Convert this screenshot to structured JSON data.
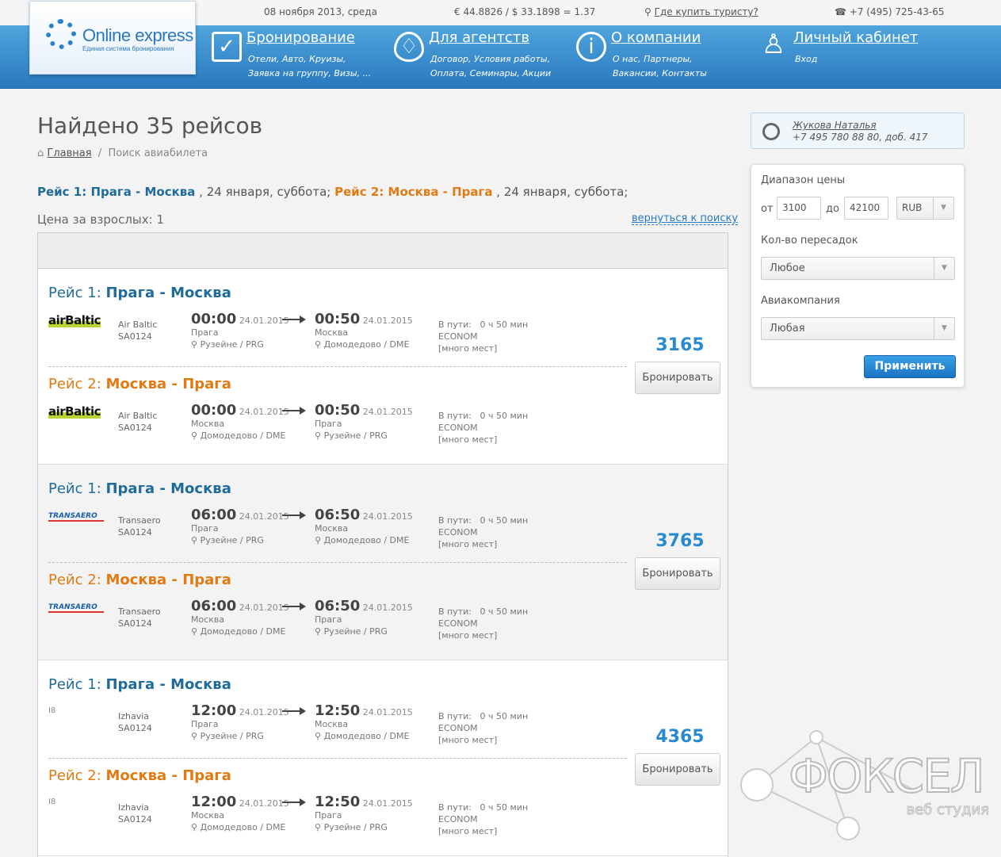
{
  "topbar": {
    "date": "08 ноября 2013, среда",
    "rates": "€ 44.8826 / $ 33.1898 = 1.37",
    "where_buy": "Где купить туристу?",
    "phone": "+7 (495) 725-43-65"
  },
  "logo": {
    "name": "Online express",
    "tagline": "Единая система бронирования"
  },
  "nav": [
    {
      "title": "Бронирование",
      "icon": "checkbox-icon",
      "links1": "Отели, Авто, Круизы,",
      "links2": "Заявка на группу, Визы, ..."
    },
    {
      "title": "Для агентств",
      "icon": "balloon-icon",
      "links1": "Договор, Условия работы,",
      "links2": "Оплата, Семинары, Акции"
    },
    {
      "title": "О компании",
      "icon": "info-icon",
      "links1": "О нас, Партнеры,",
      "links2": "Вакансии, Контакты"
    },
    {
      "title": "Личный кабинет",
      "icon": "user-icon",
      "links1": "Вход",
      "links2": ""
    }
  ],
  "page": {
    "title": "Найдено 35 рейсов",
    "crumb_home": "Главная",
    "crumb_sep": "/",
    "crumb_current": "Поиск авиабилета",
    "route_1": "Рейс 1: Прага - Москва",
    "route_1_date": " , 24 января, суббота; ",
    "route_2": "Рейс 2: Москва - Прага",
    "route_2_date": " , 24 января, суббота;",
    "adults": "Цена за взрослых: 1",
    "back": "вернуться к поиску"
  },
  "labels": {
    "leg1_prefix": "Рейс 1: ",
    "leg2_prefix": "Рейс 2: ",
    "leg1_route": "Прага - Москва",
    "leg2_route": "Москва - Прага",
    "in_way": "В пути:",
    "duration": "0 ч 50 мин",
    "class": "ECONOM",
    "seats": "[много мест]",
    "book": "Бронировать",
    "currency": "RUB",
    "flight_no": "SA0124",
    "date": "24.01.2015",
    "prague": "Прага",
    "moscow": "Москва",
    "prg": "Рузейне / PRG",
    "dme": "Домодедово / DME"
  },
  "flights": [
    {
      "airline": "Air Baltic",
      "logo": "airBaltic",
      "dep": "00:00",
      "arr": "00:50",
      "price": "3165"
    },
    {
      "airline": "Transaero",
      "logo": "TRANSAERO",
      "dep": "06:00",
      "arr": "06:50",
      "price": "3765"
    },
    {
      "airline": "Izhavia",
      "logo": "I8",
      "dep": "12:00",
      "arr": "12:50",
      "price": "4365"
    }
  ],
  "manager": {
    "name": "Жукова Наталья",
    "phone": "+7 495 780 88 80, доб. 417"
  },
  "filter": {
    "price_label": "Диапазон цены",
    "from_label": "от",
    "from_value": "3100",
    "to_label": "до",
    "to_value": "42100",
    "currency": "RUB",
    "transfers_label": "Кол-во пересадок",
    "transfers_value": "Любое",
    "airline_label": "Авиакомпания",
    "airline_value": "Любая",
    "apply": "Применить"
  },
  "watermark": {
    "brand": "ФОКСЕЛ",
    "sub": "веб студия"
  }
}
